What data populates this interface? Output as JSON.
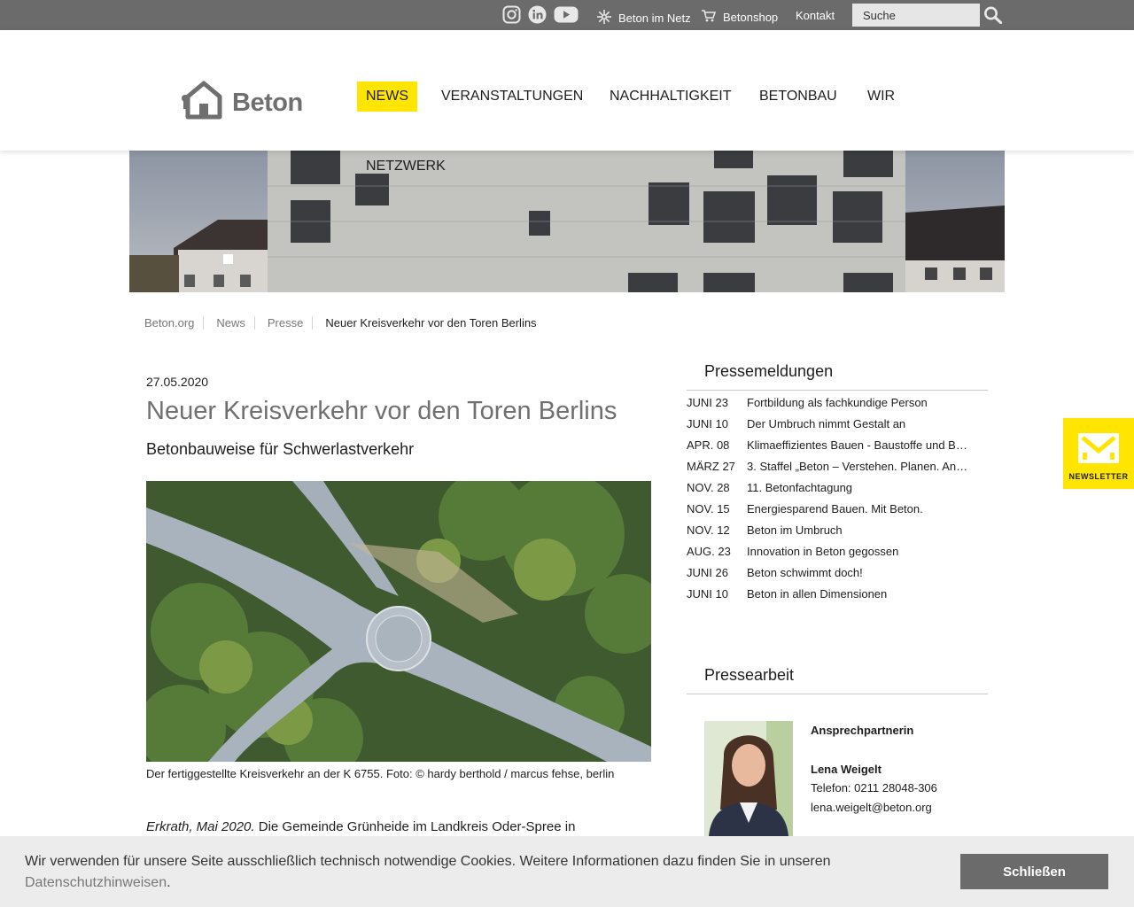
{
  "topbar": {
    "social_icons": [
      "instagram-icon",
      "linkedin-icon",
      "youtube-icon"
    ],
    "links": [
      {
        "label": "Beton im Netz",
        "icon": "network-icon"
      },
      {
        "label": "Betonshop",
        "icon": "cart-icon"
      },
      {
        "label": "Kontakt"
      }
    ],
    "search_placeholder": "Suche"
  },
  "header": {
    "logo_text": "Beton",
    "nav": [
      "NEWS",
      "VERANSTALTUNGEN",
      "NACHHALTIGKEIT",
      "BETONBAU",
      "WIR",
      "NETZWERK"
    ],
    "active_nav": "NEWS"
  },
  "breadcrumb": [
    "Beton.org",
    "News",
    "Presse",
    "Neuer Kreisverkehr vor den Toren Berlins"
  ],
  "article": {
    "date": "27.05.2020",
    "title": "Neuer Kreisverkehr vor den Toren Berlins",
    "subtitle": "Betonbauweise für Schwerlastverkehr",
    "caption": "Der fertiggestellte Kreisverkehr an der K 6755. Foto: © hardy berthold / marcus fehse, berlin",
    "lead_place": "Erkrath, Mai  2020.",
    "lead_text": " Die Gemeinde Grünheide im Landkreis Oder-Spree in"
  },
  "sidebar": {
    "press_heading": "Pressemeldungen",
    "press_items": [
      {
        "date": "JUNI 23",
        "title": "Fortbildung als fachkundige Person"
      },
      {
        "date": "JUNI 10",
        "title": "Der Umbruch nimmt Gestalt an"
      },
      {
        "date": "APR. 08",
        "title": "Klimaeffizientes Bauen - Baustoffe und B…"
      },
      {
        "date": "MÄRZ 27",
        "title": "3. Staffel „Beton – Verstehen. Planen. An…"
      },
      {
        "date": "NOV. 28",
        "title": "11. Betonfachtagung"
      },
      {
        "date": "NOV. 15",
        "title": "Energiesparend Bauen. Mit Beton."
      },
      {
        "date": "NOV. 12",
        "title": "Beton im Umbruch"
      },
      {
        "date": "AUG. 23",
        "title": "Innovation in Beton gegossen"
      },
      {
        "date": "JUNI 26",
        "title": "Beton schwimmt doch!"
      },
      {
        "date": "JUNI 10",
        "title": "Beton in allen Dimensionen"
      }
    ],
    "press_work_heading": "Pressearbeit",
    "contact": {
      "role": "Ansprechpartnerin",
      "name": "Lena Weigelt",
      "phone": "Telefon: 0211 28048-306",
      "email": "lena.weigelt@beton.org"
    }
  },
  "newsletter": {
    "label": "NEWSLETTER",
    "icon": "mail-icon"
  },
  "cookie": {
    "text": "Wir verwenden für unsere Seite ausschließlich technisch notwendige Cookies. Weitere Informationen dazu finden Sie in unseren",
    "link": "Datenschutzhinweisen",
    "suffix": ".",
    "button": "Schließen"
  },
  "colors": {
    "accent": "#ffe500",
    "topbar": "#6b6b6b",
    "cookie_bg": "#ececec",
    "title_grey": "#707070"
  }
}
